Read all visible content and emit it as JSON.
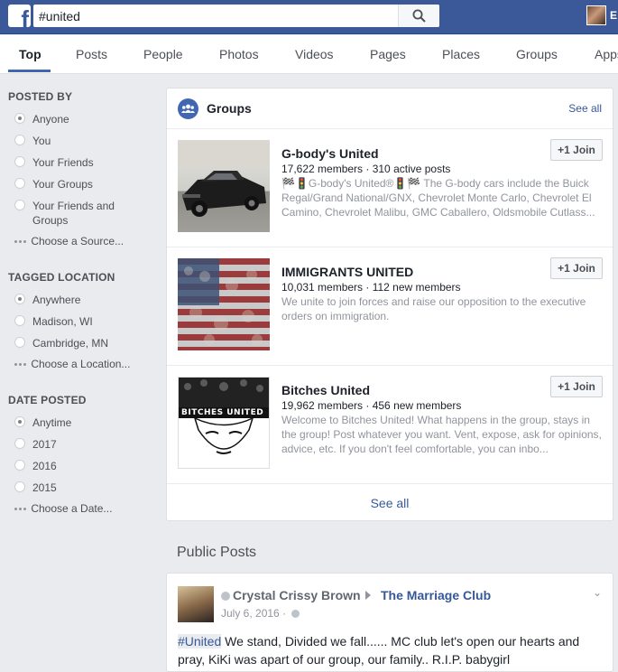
{
  "header": {
    "logo_letter": "f",
    "search_value": "#united",
    "user_initial": "E"
  },
  "tabs": [
    {
      "label": "Top",
      "active": true
    },
    {
      "label": "Posts"
    },
    {
      "label": "People"
    },
    {
      "label": "Photos"
    },
    {
      "label": "Videos"
    },
    {
      "label": "Pages"
    },
    {
      "label": "Places"
    },
    {
      "label": "Groups"
    },
    {
      "label": "Apps"
    }
  ],
  "filters": {
    "posted_by": {
      "title": "POSTED BY",
      "options": [
        "Anyone",
        "You",
        "Your Friends",
        "Your Groups",
        "Your Friends and Groups"
      ],
      "selected": "Anyone",
      "choose": "Choose a Source..."
    },
    "tagged_location": {
      "title": "TAGGED LOCATION",
      "options": [
        "Anywhere",
        "Madison, WI",
        "Cambridge, MN"
      ],
      "selected": "Anywhere",
      "choose": "Choose a Location..."
    },
    "date_posted": {
      "title": "DATE POSTED",
      "options": [
        "Anytime",
        "2017",
        "2016",
        "2015"
      ],
      "selected": "Anytime",
      "choose": "Choose a Date..."
    }
  },
  "groups": {
    "title": "Groups",
    "see_all_top": "See all",
    "join_label": "Join",
    "items": [
      {
        "name": "G-body's United",
        "stats": "17,622 members · 310 active posts",
        "description": "🏁🚦G-body's United®🚦🏁 The G-body cars include the Buick Regal/Grand National/GNX, Chevrolet Monte Carlo, Chevrolet El Camino, Chevrolet Malibu, GMC Caballero, Oldsmobile Cutlass..."
      },
      {
        "name": "IMMIGRANTS UNITED",
        "stats": "10,031 members · 112 new members",
        "description": "We unite to join forces and raise our opposition to the executive orders on immigration."
      },
      {
        "name": "Bitches United",
        "stats": "19,962 members · 456 new members",
        "description": "Welcome to Bitches United! What happens in the group, stays in the group! Post whatever you want. Vent, expose, ask for opinions, advice, etc. If you don't feel comfortable, you can inbo...",
        "thumb_text": "BITCHES UNITED"
      }
    ],
    "see_all_bottom": "See all"
  },
  "public_posts": {
    "title": "Public Posts",
    "post": {
      "author": "Crystal Crissy Brown",
      "group": "The Marriage Club",
      "date": "July 6, 2016 ·",
      "hashtag": "#United",
      "text": " We stand, Divided we fall...... MC club let's open our hearts and pray, KiKi was apart of our group, our family.. R.I.P. babygirl"
    }
  },
  "colors": {
    "brand": "#3b5998",
    "link": "#365899",
    "background": "#e9ebee"
  }
}
